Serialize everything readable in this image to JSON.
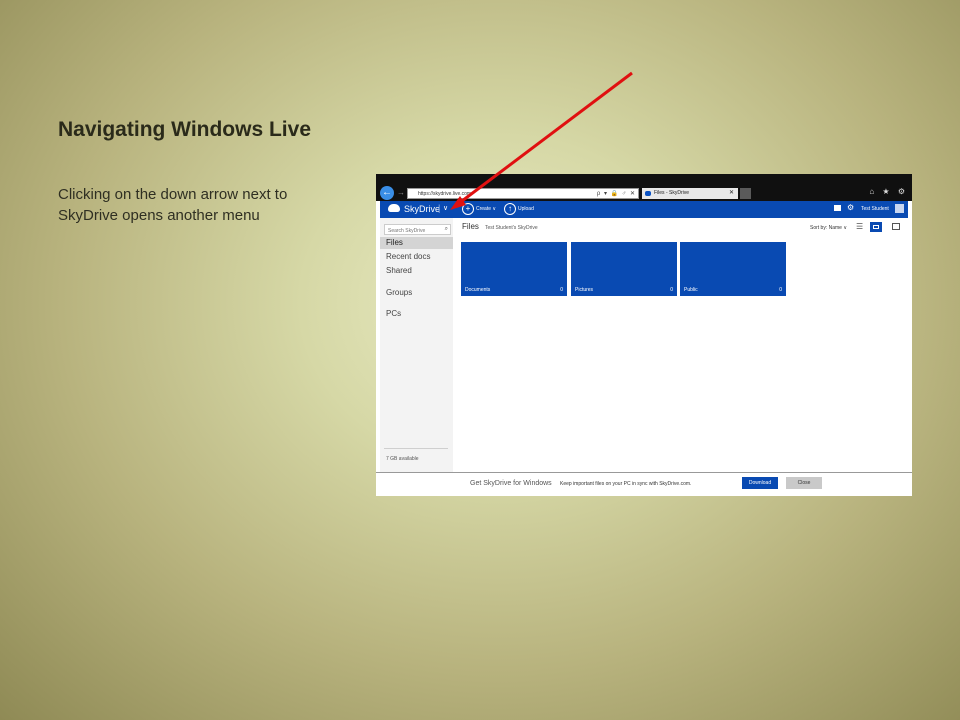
{
  "slide": {
    "title": "Navigating Windows Live",
    "body": "Clicking on the down arrow next to SkyDrive opens another menu"
  },
  "colors": {
    "skydrive_blue": "#094ab2",
    "annotation_arrow": "#e01010",
    "browser_chrome": "#101010",
    "sidebar_bg": "#f3f3f3"
  },
  "browser": {
    "address": "https://skydrive.live.com",
    "address_tools": "ρ ▾ 🔒 ♂ ✕",
    "tab_title": "Files - SkyDrive",
    "tab_close": "✕",
    "right_icons": "⌂ ★ ⚙"
  },
  "skydrive": {
    "brand": "SkyDrive",
    "menu_arrow": "∨",
    "create_label": "Create ∨",
    "upload_label": "Upload",
    "user_name": "Test Student",
    "search_placeholder": "Search SkyDrive",
    "nav": [
      "Files",
      "Recent docs",
      "Shared",
      "Groups",
      "PCs"
    ],
    "storage": "7 GB available",
    "content_title": "Files",
    "breadcrumb": "Test Student's SkyDrive",
    "sort_label": "Sort by: Name ∨",
    "folders": [
      {
        "name": "Documents",
        "count": "0"
      },
      {
        "name": "Pictures",
        "count": "0"
      },
      {
        "name": "Public",
        "count": "0"
      }
    ]
  },
  "footer": {
    "title": "Get SkyDrive for Windows",
    "message": "Keep important files on your PC in sync with SkyDrive.com.",
    "download_label": "Download",
    "close_label": "Close"
  }
}
